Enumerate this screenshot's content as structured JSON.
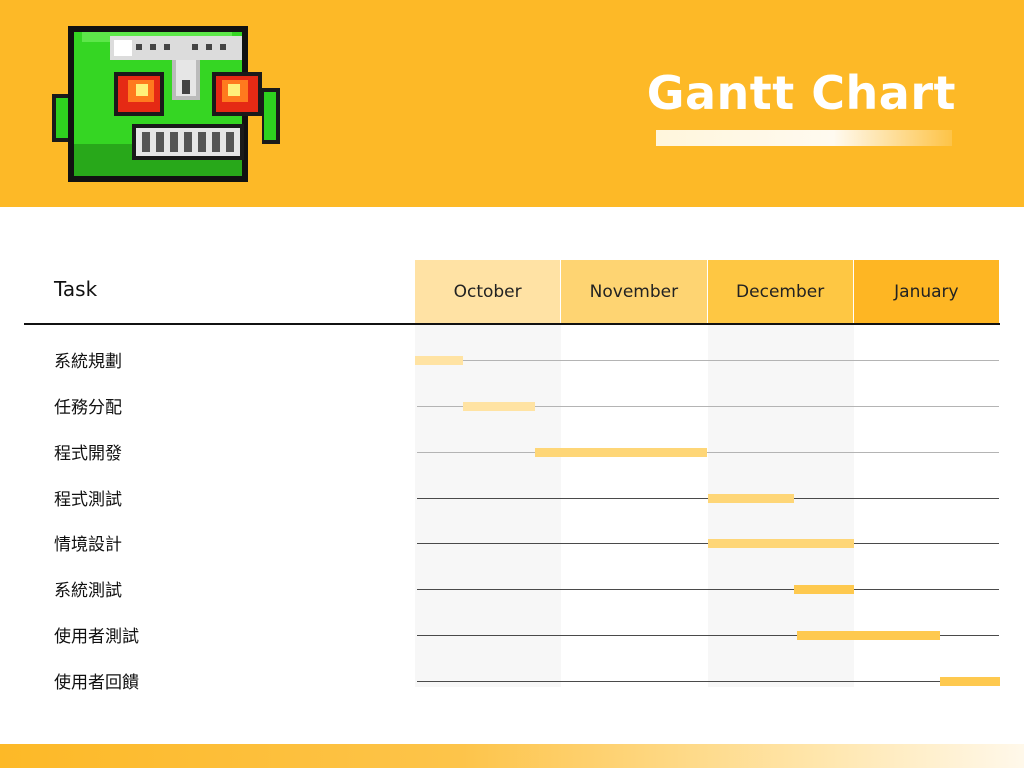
{
  "title": "Gantt Chart",
  "logo": {
    "icon": "robot-head-icon"
  },
  "colors": {
    "header_bg": "#fdb927",
    "month_1": "#ffe2a4",
    "month_2": "#fed472",
    "month_3": "#fec743",
    "month_4": "#feb623",
    "bar_light": "#ffe3a3",
    "bar_mid": "#fed677",
    "bar_dark": "#fec94f"
  },
  "chart_data": {
    "type": "gantt",
    "task_header": "Task",
    "months": [
      "October",
      "November",
      "December",
      "January"
    ],
    "tasks": [
      {
        "name": "系統規劃",
        "start": 0.0,
        "end": 0.33
      },
      {
        "name": "任務分配",
        "start": 0.33,
        "end": 0.82
      },
      {
        "name": "程式開發",
        "start": 0.82,
        "end": 2.0
      },
      {
        "name": "程式測試",
        "start": 2.0,
        "end": 2.59
      },
      {
        "name": "情境設計",
        "start": 2.0,
        "end": 3.0
      },
      {
        "name": "系統測試",
        "start": 2.59,
        "end": 3.0
      },
      {
        "name": "使用者測試",
        "start": 2.61,
        "end": 3.59
      },
      {
        "name": "使用者回饋",
        "start": 3.59,
        "end": 4.0
      }
    ]
  }
}
